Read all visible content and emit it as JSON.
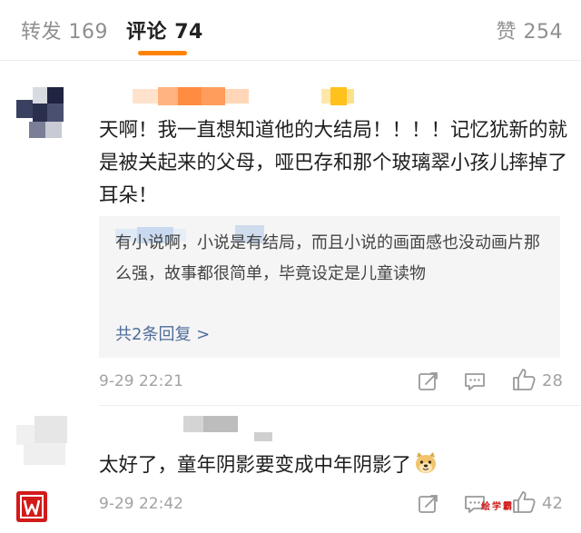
{
  "tabs": {
    "repost_label": "转发",
    "repost_count": "169",
    "comment_label": "评论",
    "comment_count": "74",
    "like_label": "赞",
    "like_count": "254"
  },
  "comments": [
    {
      "text": "天啊！我一直想知道他的大结局！！！！记忆犹新的就是被关起来的父母，哑巴存和那个玻璃翠小孩儿摔掉了耳朵！",
      "reply_text": "有小说啊，小说是有结局，而且小说的画面感也没动画片那么强，故事都很简单，毕竟设定是儿童读物",
      "reply_link": "共2条回复 >",
      "time": "9-29 22:21",
      "likes": "28"
    },
    {
      "text": "太好了，童年阴影要变成中年阴影了",
      "time": "9-29 22:42",
      "likes": "42"
    }
  ],
  "watermark": "绘学霸",
  "colors": {
    "accent": "#ff8200",
    "link": "#506d9a",
    "muted": "#a2a2a2",
    "logo_red": "#d21a1a"
  }
}
